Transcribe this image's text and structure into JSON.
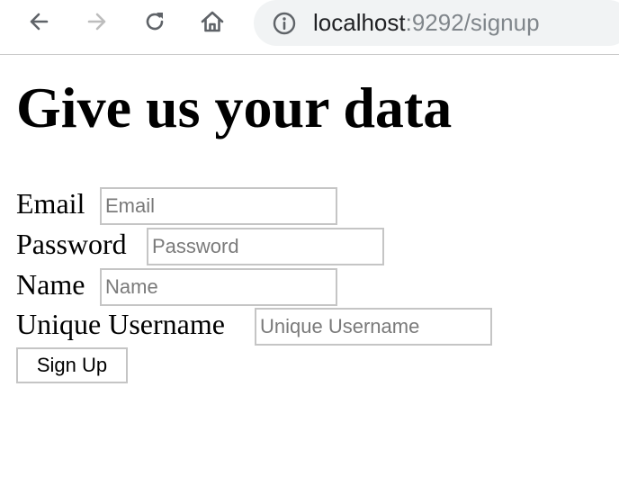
{
  "browser": {
    "url_host": "localhost",
    "url_rest": ":9292/signup",
    "icons": {
      "back": "back-arrow-icon",
      "forward": "forward-arrow-icon",
      "reload": "reload-icon",
      "home": "home-icon",
      "info": "info-icon"
    }
  },
  "page": {
    "title": "Give us your data",
    "form": {
      "email": {
        "label": "Email",
        "placeholder": "Email",
        "value": ""
      },
      "password": {
        "label": "Password",
        "placeholder": "Password",
        "value": ""
      },
      "name": {
        "label": "Name",
        "placeholder": "Name",
        "value": ""
      },
      "username": {
        "label": "Unique Username",
        "placeholder": "Unique Username",
        "value": ""
      },
      "submit_label": "Sign Up"
    }
  },
  "colors": {
    "address_bar_bg": "#f1f3f4",
    "url_host": "#202124",
    "url_rest": "#80868b",
    "field_border": "#c5c5c5",
    "placeholder": "#7a7a7a",
    "forward_disabled": "#bdbdbd"
  }
}
